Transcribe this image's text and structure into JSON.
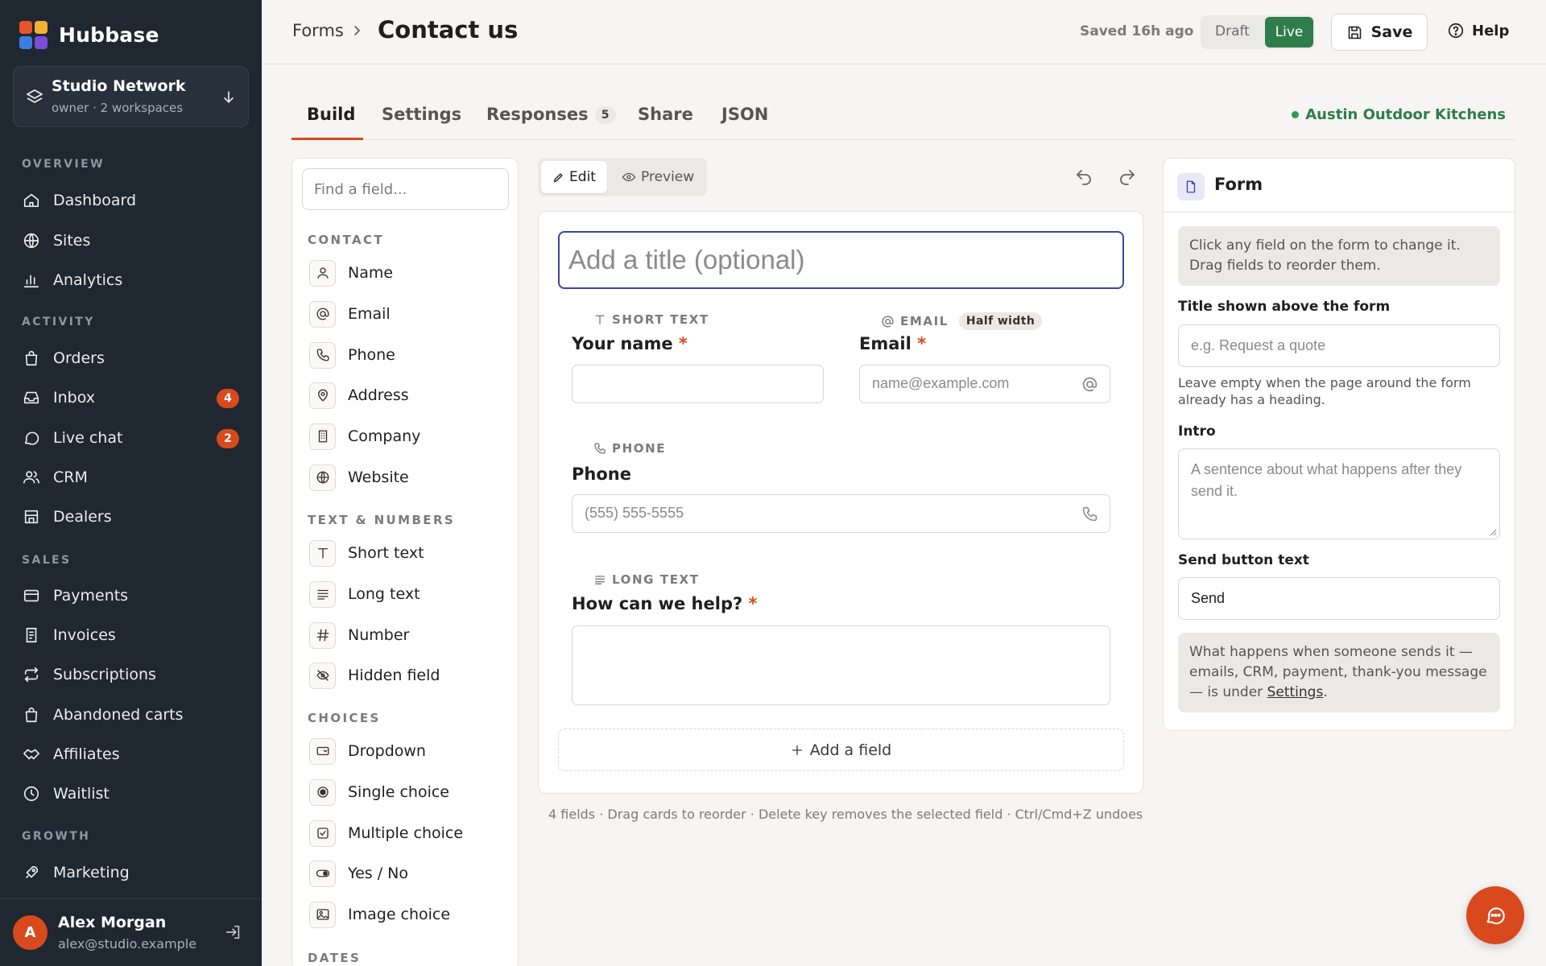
{
  "app": {
    "brand": "Hubbase",
    "logo_colors": [
      "#e8542a",
      "#f2b233",
      "#3a7ee0",
      "#7a4fd6"
    ]
  },
  "workspace": {
    "name": "Studio Network",
    "subtitle": "owner · 2 workspaces"
  },
  "sidebar": {
    "sections": [
      {
        "title": "OVERVIEW",
        "items": [
          {
            "label": "Dashboard",
            "icon": "home-icon"
          },
          {
            "label": "Sites",
            "icon": "globe-icon"
          },
          {
            "label": "Analytics",
            "icon": "bar-chart-icon"
          }
        ]
      },
      {
        "title": "ACTIVITY",
        "items": [
          {
            "label": "Orders",
            "icon": "bag-icon"
          },
          {
            "label": "Inbox",
            "icon": "inbox-icon",
            "badge": "4"
          },
          {
            "label": "Live chat",
            "icon": "chat-icon",
            "badge": "2"
          },
          {
            "label": "CRM",
            "icon": "users-icon"
          },
          {
            "label": "Dealers",
            "icon": "store-icon"
          }
        ]
      },
      {
        "title": "SALES",
        "items": [
          {
            "label": "Payments",
            "icon": "credit-card-icon"
          },
          {
            "label": "Invoices",
            "icon": "invoice-icon"
          },
          {
            "label": "Subscriptions",
            "icon": "repeat-icon"
          },
          {
            "label": "Abandoned carts",
            "icon": "bag-icon"
          },
          {
            "label": "Affiliates",
            "icon": "handshake-icon"
          },
          {
            "label": "Waitlist",
            "icon": "clock-icon"
          }
        ]
      },
      {
        "title": "GROWTH",
        "items": [
          {
            "label": "Marketing",
            "icon": "rocket-icon"
          }
        ]
      }
    ]
  },
  "user": {
    "initial": "A",
    "name": "Alex Morgan",
    "email": "alex@studio.example"
  },
  "header": {
    "breadcrumb": "Forms",
    "title": "Contact us",
    "saved": "Saved 16h ago",
    "status_draft": "Draft",
    "status_live": "Live",
    "save_label": "Save",
    "help_label": "Help"
  },
  "tabs": {
    "build": "Build",
    "settings": "Settings",
    "responses": "Responses",
    "responses_count": "5",
    "share": "Share",
    "json": "JSON",
    "site": "Austin Outdoor Kitchens"
  },
  "palette": {
    "search_placeholder": "Find a field...",
    "sections": [
      {
        "title": "CONTACT",
        "items": [
          {
            "label": "Name",
            "icon": "person-icon"
          },
          {
            "label": "Email",
            "icon": "at-icon"
          },
          {
            "label": "Phone",
            "icon": "phone-icon"
          },
          {
            "label": "Address",
            "icon": "map-pin-icon"
          },
          {
            "label": "Company",
            "icon": "building-icon"
          },
          {
            "label": "Website",
            "icon": "globe-icon"
          }
        ]
      },
      {
        "title": "TEXT & NUMBERS",
        "items": [
          {
            "label": "Short text",
            "icon": "text-icon"
          },
          {
            "label": "Long text",
            "icon": "paragraph-icon"
          },
          {
            "label": "Number",
            "icon": "hash-icon"
          },
          {
            "label": "Hidden field",
            "icon": "eye-off-icon"
          }
        ]
      },
      {
        "title": "CHOICES",
        "items": [
          {
            "label": "Dropdown",
            "icon": "dropdown-icon"
          },
          {
            "label": "Single choice",
            "icon": "radio-icon"
          },
          {
            "label": "Multiple choice",
            "icon": "checkbox-icon"
          },
          {
            "label": "Yes / No",
            "icon": "toggle-icon"
          },
          {
            "label": "Image choice",
            "icon": "image-icon"
          }
        ]
      },
      {
        "title": "DATES",
        "items": []
      }
    ]
  },
  "canvas": {
    "mode_edit": "Edit",
    "mode_preview": "Preview",
    "title_placeholder": "Add a title (optional)",
    "fields": {
      "name": {
        "caption": "SHORT TEXT",
        "label": "Your name",
        "required": "*"
      },
      "email": {
        "caption": "EMAIL",
        "badge": "Half width",
        "label": "Email",
        "required": "*",
        "placeholder": "name@example.com"
      },
      "phone": {
        "caption": "PHONE",
        "label": "Phone",
        "placeholder": "(555) 555-5555"
      },
      "help": {
        "caption": "LONG TEXT",
        "label": "How can we help?",
        "required": "*"
      }
    },
    "add_field": "Add a field",
    "hint": "4 fields · Drag cards to reorder · Delete key removes the selected field · Ctrl/Cmd+Z undoes"
  },
  "inspector": {
    "title": "Form",
    "note": "Click any field on the form to change it. Drag fields to reorder them.",
    "title_label": "Title shown above the form",
    "title_placeholder": "e.g. Request a quote",
    "title_help": "Leave empty when the page around the form already has a heading.",
    "intro_label": "Intro",
    "intro_placeholder": "A sentence about what happens after they send it.",
    "send_label": "Send button text",
    "send_value": "Send",
    "footer_note": "What happens when someone sends it — emails, CRM, payment, thank-you message — is under ",
    "footer_link": "Settings",
    "footer_end": "."
  },
  "colors": {
    "sidebar_bg": "#1f2730",
    "accent": "#d9491e",
    "live_green": "#2f7d4a",
    "focus_indigo": "#3e44a8"
  }
}
